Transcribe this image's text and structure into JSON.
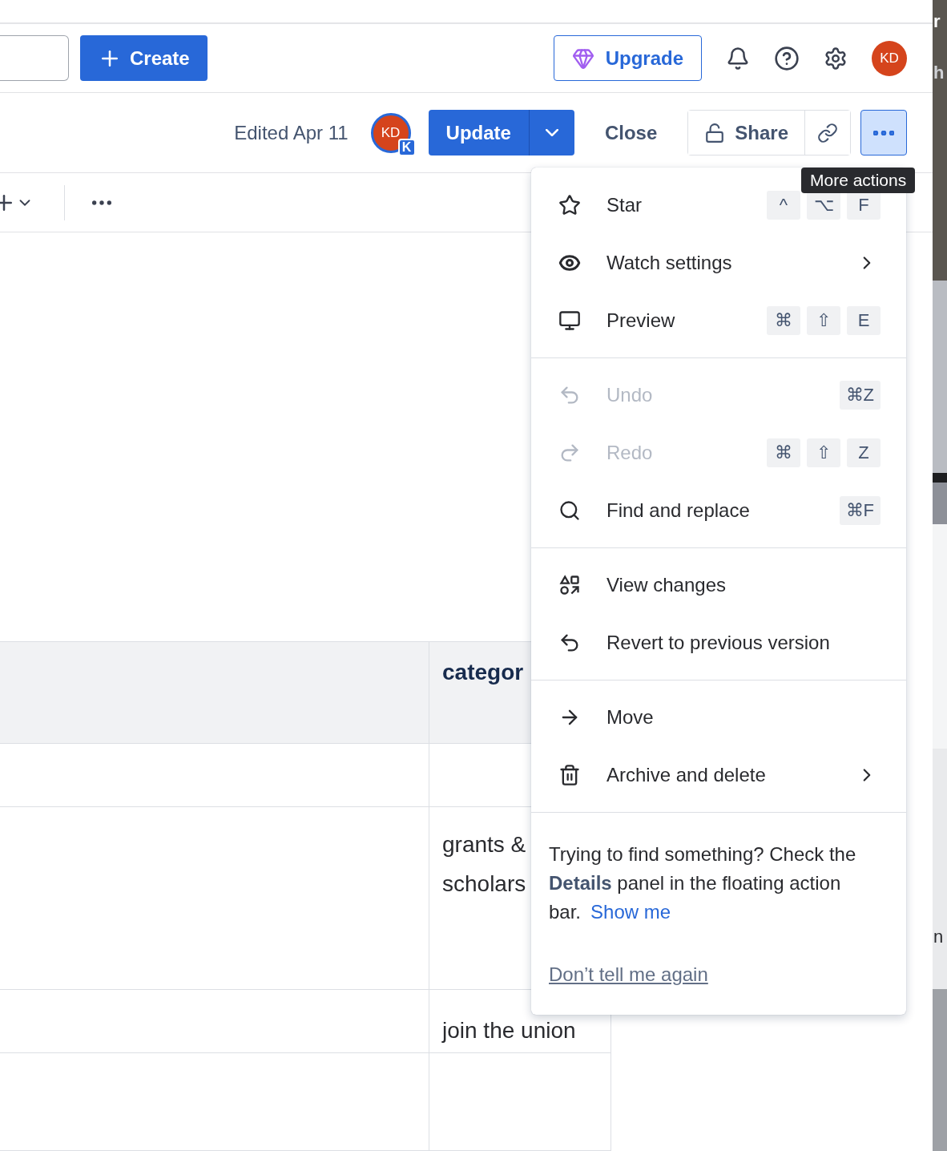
{
  "header": {
    "create_label": "Create",
    "upgrade_label": "Upgrade",
    "avatar_initials": "KD"
  },
  "doc_bar": {
    "edited": "Edited Apr 11",
    "avatar_initials": "KD",
    "avatar_badge": "K",
    "update_label": "Update",
    "close_label": "Close",
    "share_label": "Share",
    "more_selected": true
  },
  "table": {
    "columns": [
      {
        "label": "categor"
      }
    ],
    "rows": [
      {
        "cells": [
          ""
        ]
      },
      {
        "cells": [
          "grants &\nscholars"
        ]
      },
      {
        "cells": [
          "join the union"
        ]
      },
      {
        "cells": [
          ""
        ]
      }
    ]
  },
  "menu": {
    "sections": [
      {
        "items": [
          {
            "kind": "star",
            "label": "Star",
            "disabled": false,
            "submenu": false,
            "keys": [
              "^",
              "⌥",
              "F"
            ]
          },
          {
            "kind": "eye",
            "label": "Watch settings",
            "disabled": false,
            "submenu": true
          },
          {
            "kind": "monitor",
            "label": "Preview",
            "disabled": false,
            "submenu": false,
            "keys": [
              "⌘",
              "⇧",
              "E"
            ]
          }
        ]
      },
      {
        "items": [
          {
            "kind": "undo",
            "label": "Undo",
            "disabled": true,
            "submenu": false,
            "keys": [
              "⌘Z"
            ]
          },
          {
            "kind": "redo",
            "label": "Redo",
            "disabled": true,
            "submenu": false,
            "keys": [
              "⌘",
              "⇧",
              "Z"
            ]
          },
          {
            "kind": "search",
            "label": "Find and replace",
            "disabled": false,
            "submenu": false,
            "keys": [
              "⌘F"
            ]
          }
        ]
      },
      {
        "items": [
          {
            "kind": "changes",
            "label": "View changes",
            "disabled": false,
            "submenu": false
          },
          {
            "kind": "revert",
            "label": "Revert to previous version",
            "disabled": false,
            "submenu": false
          }
        ]
      },
      {
        "items": [
          {
            "kind": "arrow",
            "label": "Move",
            "disabled": false,
            "submenu": false
          },
          {
            "kind": "trash",
            "label": "Archive and delete",
            "disabled": false,
            "submenu": true
          }
        ]
      }
    ],
    "tip": "Trying to find something? Check the **Details** panel in the floating action bar.",
    "tip_link": "Show me",
    "dismiss": "Don’t tell me again"
  },
  "tooltip": "More actions",
  "background_window": {
    "fragments": [
      "r",
      "h",
      "n"
    ]
  }
}
